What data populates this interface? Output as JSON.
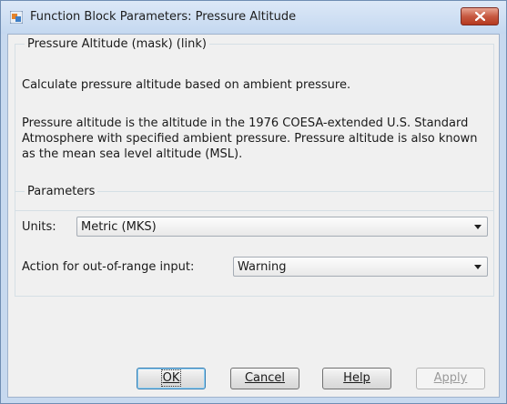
{
  "window": {
    "title": "Function Block Parameters: Pressure Altitude"
  },
  "description": {
    "group_title": "Pressure Altitude (mask) (link)",
    "summary": "Calculate pressure altitude based on ambient pressure.",
    "detail": "Pressure altitude is the altitude in the 1976 COESA-extended U.S. Standard Atmosphere with specified ambient pressure.  Pressure altitude is also known as the mean sea level altitude (MSL)."
  },
  "parameters": {
    "group_title": "Parameters",
    "units_label": "Units:",
    "units_value": "Metric (MKS)",
    "action_label": "Action for out-of-range input:",
    "action_value": "Warning"
  },
  "buttons": {
    "ok": "OK",
    "cancel": "Cancel",
    "help": "Help",
    "apply": "Apply"
  },
  "colors": {
    "window_frame": "#c7d9ef",
    "client_background": "#f0f0f0",
    "close_button": "#c75a42"
  },
  "icons": {
    "app": "simulink-block-icon",
    "close": "close-icon",
    "dropdown": "chevron-down-icon"
  }
}
